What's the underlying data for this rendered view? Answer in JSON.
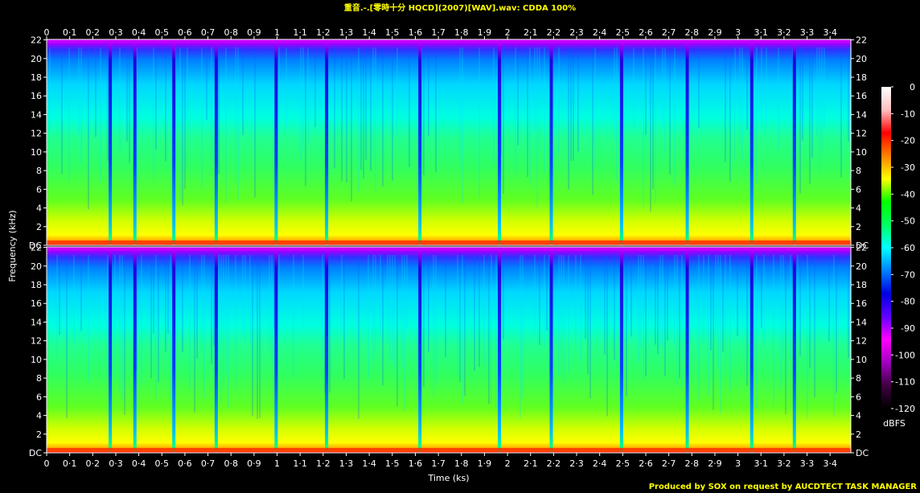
{
  "header": {
    "title": "重音.-.[零時十分 HQCD](2007)[WAV].wav: CDDA 100%"
  },
  "footer": {
    "credit": "Produced by SOX on request by AUCDTECT TASK MANAGER"
  },
  "chart_data": {
    "type": "heatmap",
    "title": "重音.-.[零時十分 HQCD](2007)[WAV].wav: CDDA 100%",
    "xlabel": "Time (ks)",
    "ylabel": "Frequency (kHz)",
    "colorbar_label": "dBFS",
    "x_tick_labels": [
      "0",
      "0·1",
      "0·2",
      "0·3",
      "0·4",
      "0·5",
      "0·6",
      "0·7",
      "0·8",
      "0·9",
      "1",
      "1·1",
      "1·2",
      "1·3",
      "1·4",
      "1·5",
      "1·6",
      "1·7",
      "1·8",
      "1·9",
      "2",
      "2·1",
      "2·2",
      "2·3",
      "2·4",
      "2·5",
      "2·6",
      "2·7",
      "2·8",
      "2·9",
      "3",
      "3·1",
      "3·2",
      "3·3",
      "3·4"
    ],
    "x_tick_values": [
      0,
      0.1,
      0.2,
      0.3,
      0.4,
      0.5,
      0.6,
      0.7,
      0.8,
      0.9,
      1.0,
      1.1,
      1.2,
      1.3,
      1.4,
      1.5,
      1.6,
      1.7,
      1.8,
      1.9,
      2.0,
      2.1,
      2.2,
      2.3,
      2.4,
      2.5,
      2.6,
      2.7,
      2.8,
      2.9,
      3.0,
      3.1,
      3.2,
      3.3,
      3.4
    ],
    "xlim": [
      0,
      3.49
    ],
    "y_tick_labels": [
      "DC",
      "2",
      "4",
      "6",
      "8",
      "10",
      "12",
      "14",
      "16",
      "18",
      "20",
      "22"
    ],
    "y_tick_values": [
      0,
      2,
      4,
      6,
      8,
      10,
      12,
      14,
      16,
      18,
      20,
      22
    ],
    "ylim": [
      0,
      22.05
    ],
    "channels": 2,
    "colorbar_tick_labels": [
      "0",
      "-10",
      "-20",
      "-30",
      "-40",
      "-50",
      "-60",
      "-70",
      "-80",
      "-90",
      "-100",
      "-110",
      "-120"
    ],
    "colorbar_tick_values": [
      0,
      -10,
      -20,
      -30,
      -40,
      -50,
      -60,
      -70,
      -80,
      -90,
      -100,
      -110,
      -120
    ],
    "colorbar_range": [
      -120,
      0
    ],
    "colormap": [
      "#000000",
      "#400040",
      "#a000c0",
      "#ff00ff",
      "#6000ff",
      "#0000e0",
      "#0080ff",
      "#00ffff",
      "#00ff60",
      "#00ff00",
      "#ffff00",
      "#ff8000",
      "#ff0000",
      "#ffc0c0",
      "#ffffff"
    ],
    "track_boundaries_ks": [
      0.276,
      0.383,
      0.552,
      0.736,
      0.996,
      1.215,
      1.62,
      1.965,
      2.19,
      2.495,
      2.78,
      3.06,
      3.245
    ]
  }
}
